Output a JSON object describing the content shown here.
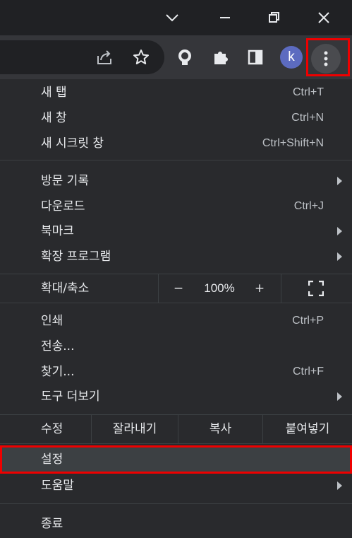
{
  "menu": {
    "new_tab": {
      "label": "새 탭",
      "shortcut": "Ctrl+T"
    },
    "new_window": {
      "label": "새 창",
      "shortcut": "Ctrl+N"
    },
    "new_incognito": {
      "label": "새 시크릿 창",
      "shortcut": "Ctrl+Shift+N"
    },
    "history": {
      "label": "방문 기록"
    },
    "downloads": {
      "label": "다운로드",
      "shortcut": "Ctrl+J"
    },
    "bookmarks": {
      "label": "북마크"
    },
    "extensions": {
      "label": "확장 프로그램"
    },
    "zoom": {
      "label": "확대/축소",
      "minus": "−",
      "value": "100%",
      "plus": "+"
    },
    "print": {
      "label": "인쇄",
      "shortcut": "Ctrl+P"
    },
    "cast": {
      "label": "전송..."
    },
    "find": {
      "label": "찾기...",
      "shortcut": "Ctrl+F"
    },
    "more_tools": {
      "label": "도구 더보기"
    },
    "edit": {
      "label": "수정",
      "cut": "잘라내기",
      "copy": "복사",
      "paste": "붙여넣기"
    },
    "settings": {
      "label": "설정"
    },
    "help": {
      "label": "도움말"
    },
    "exit": {
      "label": "종료"
    }
  },
  "profile": {
    "initial": "k"
  },
  "colors": {
    "highlight": "#e00000",
    "avatar": "#5c6bc0"
  }
}
